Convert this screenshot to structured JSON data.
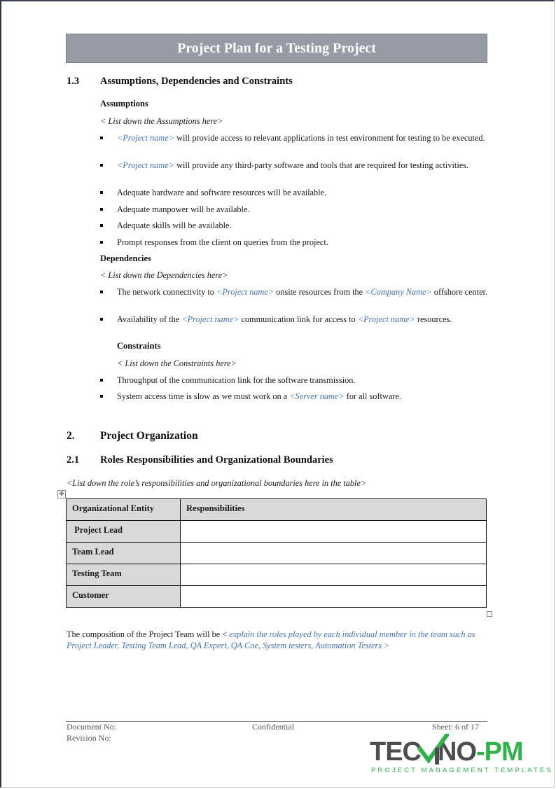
{
  "document": {
    "title": "Project Plan for a Testing Project"
  },
  "section_1_3": {
    "number": "1.3",
    "heading": "Assumptions, Dependencies and Constraints",
    "assumptions": {
      "label": "Assumptions",
      "placeholder": "< List down the Assumptions here>",
      "items": [
        {
          "ph": "<Project name>",
          "text": " will provide access to relevant applications in test environment for testing to be executed."
        },
        {
          "ph": "<Project name>",
          "text": " will provide any third-party software and tools that are required for testing activities."
        },
        {
          "text": "Adequate hardware and software resources will be available."
        },
        {
          "text": "Adequate manpower will be available."
        },
        {
          "text": "Adequate skills will be available."
        },
        {
          "text": "Prompt responses from the client on queries from the project."
        }
      ]
    },
    "dependencies": {
      "label": "Dependencies",
      "placeholder": "< List down the Dependencies here>",
      "items": [
        {
          "t1": "The network connectivity to ",
          "ph1": "<Project name>",
          "t2": " onsite resources from the ",
          "ph2": "<Company Name>",
          "t3": " offshore center."
        },
        {
          "t1": "Availability of the ",
          "ph1": "<Project name>",
          "t2": " communication link for access to ",
          "ph2": "<Project name>",
          "t3": " resources."
        }
      ]
    },
    "constraints": {
      "label": "Constraints",
      "placeholder": "< List down the Constraints here>",
      "items": [
        {
          "text": "Throughput of the communication link for the software transmission."
        },
        {
          "t1": "System access time is slow as we must work on a ",
          "ph": "<Server name>",
          "t2": " for all software."
        }
      ]
    }
  },
  "section_2": {
    "number": "2.",
    "heading": "Project Organization"
  },
  "section_2_1": {
    "number": "2.1",
    "heading": "Roles Responsibilities and Organizational Boundaries",
    "placeholder": "<List down the role’s responsibilities and organizational boundaries here in the table>",
    "table": {
      "headers": [
        "Organizational Entity",
        "Responsibilities"
      ],
      "rows": [
        {
          "entity": " Project Lead",
          "responsibilities": ""
        },
        {
          "entity": "Team Lead",
          "responsibilities": ""
        },
        {
          "entity": "Testing Team",
          "responsibilities": ""
        },
        {
          "entity": "Customer",
          "responsibilities": ""
        }
      ]
    },
    "composition_text": "The composition of the Project Team will be < ",
    "composition_placeholder": "explain the roles played by each individual member in the team such as Project Leader, Testing Team Lead, QA Expert, QA Coe, System testers, Automation Testers >"
  },
  "footer": {
    "document_no": "Document No:",
    "revision_no": "Revision No:",
    "confidential": "Confidential",
    "sheet": "Sheet: 6 of 17",
    "logo": {
      "part1": "TEC",
      "part2": "NO",
      "part3": "-PM",
      "tagline": "PROJECT MANAGEMENT TEMPLATES",
      "colors": {
        "gray": "#4d4d4f",
        "green": "#2db34a"
      }
    }
  },
  "colors": {
    "banner": "#979ba6",
    "placeholder": "#4472c4",
    "table_header": "#d9d9d9"
  }
}
